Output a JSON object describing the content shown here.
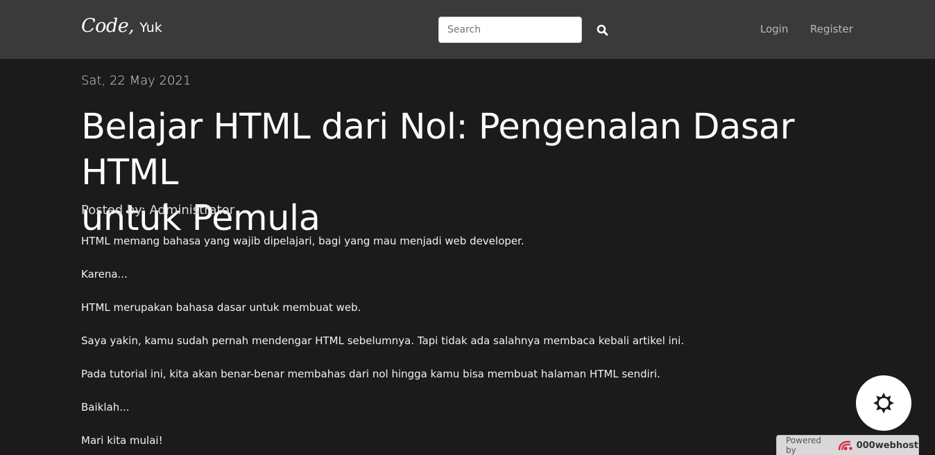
{
  "navbar": {
    "brand_code": "Code,",
    "brand_yuk": "Yuk",
    "search_placeholder": "Search",
    "search_icon": "magnifier-icon",
    "login_label": "Login",
    "register_label": "Register"
  },
  "post": {
    "date": "Sat, 22 May 2021",
    "title_line1": "Belajar HTML dari Nol: Pengenalan Dasar HTML",
    "title_line2": "untuk Pemula",
    "author": "Posted by: Administrator",
    "paragraphs": [
      "HTML memang bahasa yang wajib dipelajari, bagi yang mau menjadi web developer.",
      "Karena...",
      "HTML merupakan bahasa dasar untuk membuat web.",
      "Saya yakin, kamu sudah pernah mendengar HTML sebelumnya. Tapi tidak ada salahnya membaca kebali artikel ini.",
      "Pada tutorial ini, kita akan benar-benar membahas dari nol hingga kamu bisa membuat halaman HTML sendiri.",
      "Baiklah...",
      "Mari kita mulai!"
    ]
  },
  "widgets": {
    "theme_toggle_icon": "sun-icon",
    "powered_by_label": "Powered by",
    "powered_by_host": "000webhost"
  },
  "colors": {
    "navbar_bg": "#3a3a3a",
    "page_bg": "#1b1b1b",
    "logo_red": "#d6283b"
  }
}
